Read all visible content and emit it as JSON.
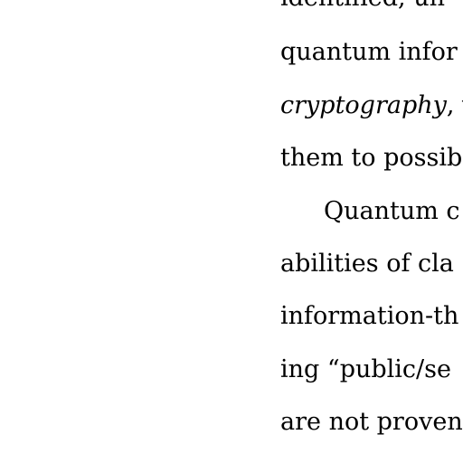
{
  "text_lines": {
    "line0": "identified, un",
    "line1": "quantum infor",
    "line2_italic": "cryptography",
    "line2_rest": ", v",
    "line3": "them to possib",
    "line4": "Quantum c",
    "line5": "abilities of cla",
    "line6": "information-th",
    "line7": "ing “public/se",
    "line8": "are not proven"
  }
}
